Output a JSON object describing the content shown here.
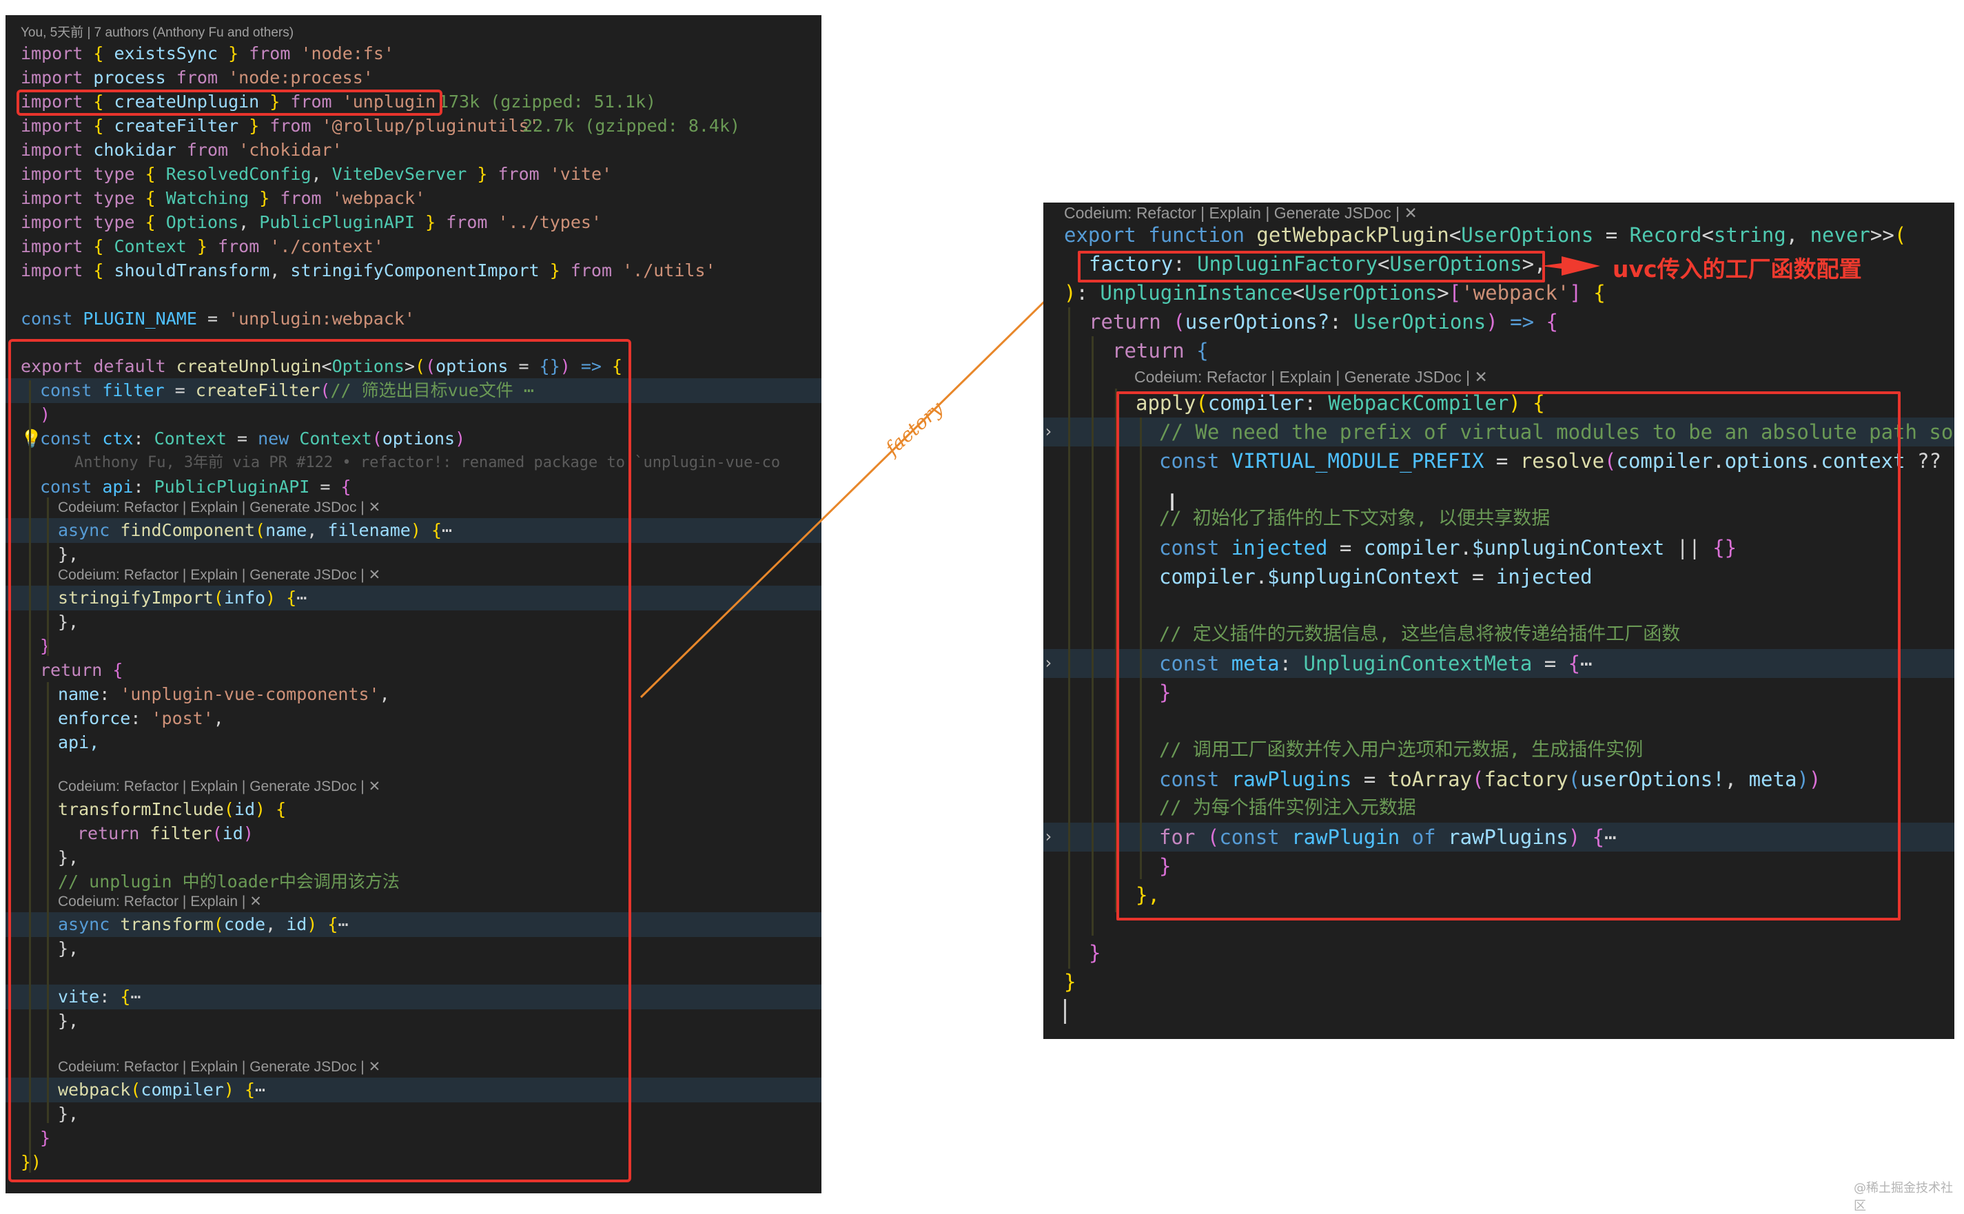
{
  "left": {
    "blame_header": "You, 5天前 | 7 authors (Anthony Fu and others)",
    "imports": [
      "import { existsSync } from 'node:fs'",
      "import process from 'node:process'",
      "import { createUnplugin } from 'unplugin'",
      "import { createFilter } from '@rollup/pluginutils'",
      "import chokidar from 'chokidar'",
      "import type { ResolvedConfig, ViteDevServer } from 'vite'",
      "import type { Watching } from 'webpack'",
      "import type { Options, PublicPluginAPI } from '../types'",
      "import { Context } from './context'",
      "import { shouldTransform, stringifyComponentImport } from './utils'"
    ],
    "import_sizes": {
      "unplugin": "173k (gzipped: 51.1k)",
      "pluginutils": "22.7k (gzipped: 8.4k)"
    },
    "plugin_name_line": "const PLUGIN_NAME = 'unplugin:webpack'",
    "export_line": "export default createUnplugin<Options>((options = {}) => {",
    "filter_line": "const filter = createFilter(// 筛选出目标vue文件 ⋯",
    "close_paren": ")",
    "ctx_line": "const ctx: Context = new Context(options)",
    "inline_blame": "Anthony Fu, 3年前 via PR #122 • refactor!: renamed package to `unplugin-vue-co",
    "api_line": "const api: PublicPluginAPI = {",
    "codelens_full": "Codeium: Refactor | Explain | Generate JSDoc | ✕",
    "codelens_short": "Codeium: Refactor | Explain | ✕",
    "find_component": "async findComponent(name, filename) {⋯",
    "stringify_import": "stringifyImport(info) {⋯",
    "closer_comma": "},",
    "closer_brace": "}",
    "return_line": "return {",
    "name_line": "name: 'unplugin-vue-components',",
    "enforce_line": "enforce: 'post',",
    "api_prop": "api,",
    "transform_include": "transformInclude(id) {",
    "return_filter": "return filter(id)",
    "loader_comment": "// unplugin 中的loader中会调用该方法",
    "transform_line": "async transform(code, id) {⋯",
    "vite_line": "vite: {⋯",
    "webpack_line": "webpack(compiler) {⋯",
    "end_line": "})"
  },
  "arrow_label": "factory",
  "right": {
    "codelens_top": "Codeium: Refactor | Explain | Generate JSDoc | ✕",
    "export_fn": "export function getWebpackPlugin<UserOptions = Record<string, never>>(",
    "factory_param": "factory: UnpluginFactory<UserOptions>,",
    "return_type": "): UnpluginInstance<UserOptions>['webpack'] {",
    "return_arrow": "return (userOptions?: UserOptions) => {",
    "return_obj": "return {",
    "codelens_inner": "Codeium: Refactor | Explain | Generate JSDoc | ✕",
    "apply_line": "apply(compiler: WebpackCompiler) {",
    "comment_prefix": "// We need the prefix of virtual modules to be an absolute path so we",
    "vmp_line": "const VIRTUAL_MODULE_PREFIX = resolve(compiler.options.context ?? proc",
    "comment_init": "// 初始化了插件的上下文对象, 以便共享数据",
    "injected_line": "const injected = compiler.$unpluginContext || {}",
    "assign_line": "compiler.$unpluginContext = injected",
    "comment_meta": "// 定义插件的元数据信息, 这些信息将被传递给插件工厂函数",
    "meta_line": "const meta: UnpluginContextMeta = {⋯",
    "close_brace": "}",
    "comment_call": "// 调用工厂函数并传入用户选项和元数据, 生成插件实例",
    "raw_plugins": "const rawPlugins = toArray(factory(userOptions!, meta))",
    "comment_inject": "// 为每个插件实例注入元数据",
    "for_line": "for (const rawPlugin of rawPlugins) {⋯",
    "close_comma": "},",
    "annotation": "uvc传入的工厂函数配置"
  },
  "watermark": "@稀土掘金技术社区",
  "colors": {
    "highlight_red": "#e8342c",
    "arrow_orange": "#e8872a",
    "editor_bg": "#1f1f1f"
  }
}
